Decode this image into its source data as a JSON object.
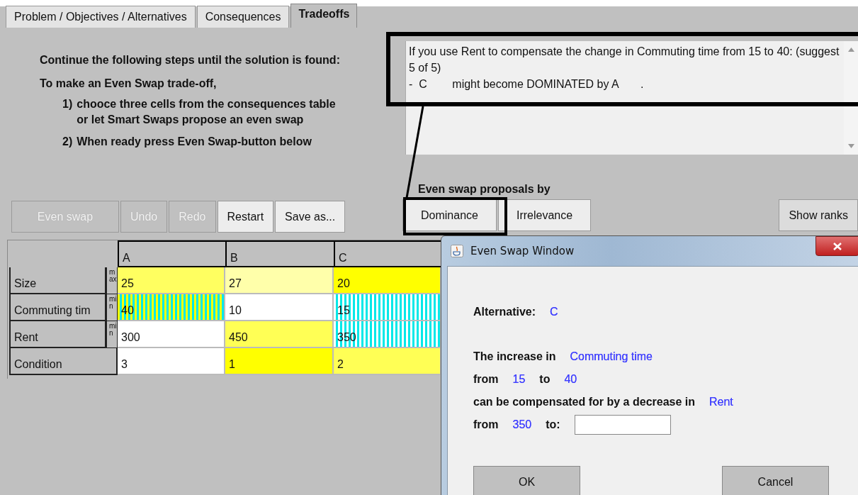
{
  "tabs": [
    {
      "label": "Problem / Objectives / Alternatives",
      "selected": false
    },
    {
      "label": "Consequences",
      "selected": false
    },
    {
      "label": "Tradeoffs",
      "selected": true
    }
  ],
  "instructions": {
    "heading": "Continue the following steps until the solution is found:",
    "intro": "To make an Even Swap trade-off,",
    "steps": [
      {
        "number": "1)",
        "lines": [
          "chooce three cells from the consequences table",
          "or let Smart Swaps propose an even swap"
        ]
      },
      {
        "number": "2)",
        "lines": [
          "When ready press Even Swap-button below"
        ]
      }
    ]
  },
  "actions": [
    {
      "label": "Even swap",
      "disabled": true
    },
    {
      "label": "Undo",
      "disabled": true
    },
    {
      "label": "Redo",
      "disabled": true
    },
    {
      "label": "Restart",
      "disabled": false
    },
    {
      "label": "Save as...",
      "disabled": false
    }
  ],
  "suggestions": {
    "lines": [
      "If you use Rent to compensate the change in Commuting time from 15 to 40: (suggest 5 of 5)",
      "-  C        might become DOMINATED by A       ."
    ]
  },
  "proposals": {
    "label": "Even swap proposals by",
    "buttons": [
      "Dominance",
      "Irrelevance"
    ]
  },
  "show_ranks": "Show ranks",
  "table": {
    "columns": [
      "A",
      "B",
      "C"
    ],
    "rows": [
      {
        "name": "Size",
        "direction": "max",
        "cells": [
          {
            "value": "25",
            "kind": "plain",
            "color": "#ffff60"
          },
          {
            "value": "27",
            "kind": "plain",
            "color": "#ffffaa"
          },
          {
            "value": "20",
            "kind": "plain",
            "color": "#ffff00"
          }
        ]
      },
      {
        "name": "Commuting tim",
        "direction": "min",
        "cells": [
          {
            "value": "40",
            "kind": "striped",
            "color": "#ffff00"
          },
          {
            "value": "10",
            "kind": "plain",
            "color": "#ffffff"
          },
          {
            "value": "15",
            "kind": "striped",
            "color": "#ffffff"
          }
        ]
      },
      {
        "name": "Rent",
        "direction": "min",
        "cells": [
          {
            "value": "300",
            "kind": "plain",
            "color": "#ffffff"
          },
          {
            "value": "450",
            "kind": "plain",
            "color": "#ffff55"
          },
          {
            "value": "350",
            "kind": "striped",
            "color": "#ffffff"
          }
        ]
      },
      {
        "name": "Condition",
        "cells": [
          {
            "value": "3",
            "kind": "plain",
            "color": "#ffffff"
          },
          {
            "value": "1",
            "kind": "plain",
            "color": "#ffff00"
          },
          {
            "value": "2",
            "kind": "plain",
            "color": "#ffff55"
          }
        ]
      }
    ]
  },
  "dialog": {
    "title": "Even Swap Window",
    "alternative": {
      "label": "Alternative:",
      "value": "C"
    },
    "lines": [
      [
        {
          "kind": "label",
          "text": "The increase in"
        },
        {
          "kind": "value",
          "text": "Commuting time"
        }
      ],
      [
        {
          "kind": "label",
          "text": "from"
        },
        {
          "kind": "value",
          "text": "15"
        },
        {
          "kind": "label",
          "text": "to"
        },
        {
          "kind": "value",
          "text": "40"
        }
      ],
      [
        {
          "kind": "label",
          "text": "can be compensated for by a decrease in"
        },
        {
          "kind": "value",
          "text": "Rent"
        }
      ],
      [
        {
          "kind": "label",
          "text": "from"
        },
        {
          "kind": "value",
          "text": "350"
        },
        {
          "kind": "label",
          "text": "to:"
        },
        {
          "kind": "input"
        }
      ]
    ],
    "buttons": [
      "OK",
      "Cancel"
    ]
  }
}
